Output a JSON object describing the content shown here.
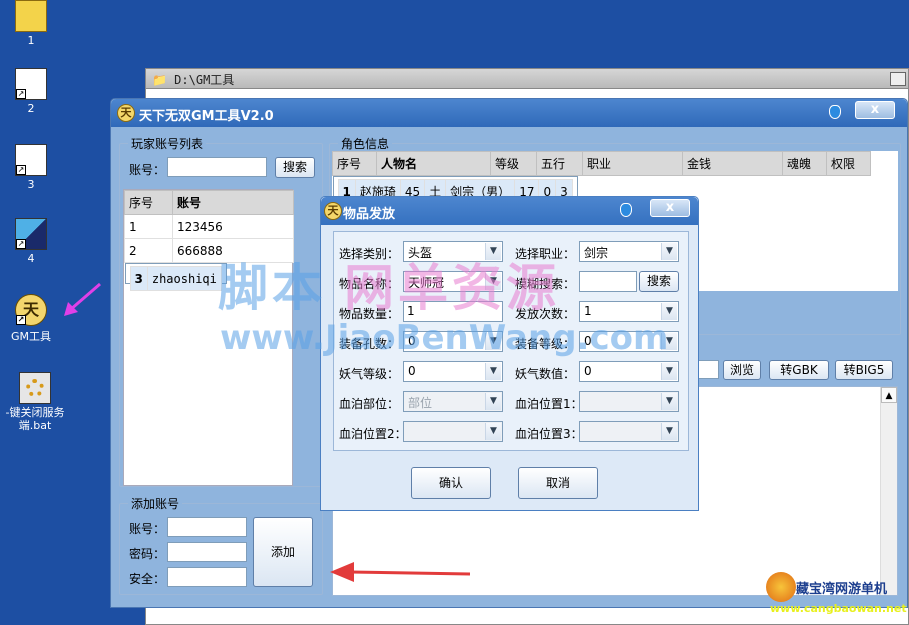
{
  "desktop": {
    "icons": [
      {
        "label": "1"
      },
      {
        "label": "2"
      },
      {
        "label": "3"
      },
      {
        "label": "4"
      },
      {
        "label": "GM工具"
      },
      {
        "label": "-键关闭服务\n端.bat"
      }
    ]
  },
  "explorer": {
    "path": "D:\\GM工具"
  },
  "gm_window": {
    "title": "天下无双GM工具V2.0",
    "close_label": "x",
    "player_list": {
      "legend": "玩家账号列表",
      "account_label": "账号：",
      "search_label": "搜索",
      "headers": [
        "序号",
        "账号"
      ],
      "rows": [
        {
          "no": "1",
          "account": "123456"
        },
        {
          "no": "2",
          "account": "666888"
        },
        {
          "no": "3",
          "account": "zhaoshiqi"
        }
      ]
    },
    "role_info": {
      "legend": "角色信息",
      "headers": [
        "序号",
        "人物名",
        "等级",
        "五行",
        "职业",
        "金钱",
        "魂魄",
        "权限"
      ],
      "rows": [
        {
          "no": "1",
          "name": "赵施琦",
          "level": "45",
          "element": "土",
          "job": "剑宗（男）",
          "money": "17",
          "soul": "0",
          "perm": "3"
        }
      ]
    },
    "tools": {
      "browse_label": "浏览",
      "gbk_label": "转GBK",
      "big5_label": "转BIG5"
    },
    "add_account": {
      "legend": "添加账号",
      "account_label": "账号：",
      "password_label": "密码：",
      "security_label": "安全：",
      "add_label": "添加"
    }
  },
  "dialog": {
    "title": "物品发放",
    "close_label": "x",
    "fields": {
      "category_label": "选择类别：",
      "category_value": "头盔",
      "job_label": "选择职业：",
      "job_value": "剑宗",
      "item_name_label": "物品名称：",
      "item_name_value": "天师冠",
      "fuzzy_label": "模糊搜索：",
      "fuzzy_search_label": "搜索",
      "qty_label": "物品数量：",
      "qty_value": "1",
      "times_label": "发放次数：",
      "times_value": "1",
      "holes_label": "装备孔数：",
      "holes_value": "0",
      "equip_level_label": "装备等级：",
      "equip_level_value": "0",
      "yaoqi_level_label": "妖气等级：",
      "yaoqi_level_value": "0",
      "yaoqi_value_label": "妖气数值：",
      "yaoqi_value_value": "0",
      "blood_part_label": "血泊部位：",
      "blood_part_value": "部位",
      "blood_pos1_label": "血泊位置1：",
      "blood_pos2_label": "血泊位置2：",
      "blood_pos3_label": "血泊位置3："
    },
    "confirm_label": "确认",
    "cancel_label": "取消"
  },
  "watermark": {
    "line1": "脚本",
    "line1b": "网单资源",
    "line2": "www.JiaoBenWang.com"
  },
  "corner_logo": {
    "name": "藏宝湾网游单机",
    "url": "www.cangbaowan.net"
  },
  "colors": {
    "desktop": "#1d4fa3",
    "title_bar": "#3a75c3",
    "watermark_blue": "#5aa0e6",
    "watermark_pink": "#e77bd0",
    "arrow_red": "#e23b3b",
    "arrow_magenta": "#e040e8"
  }
}
